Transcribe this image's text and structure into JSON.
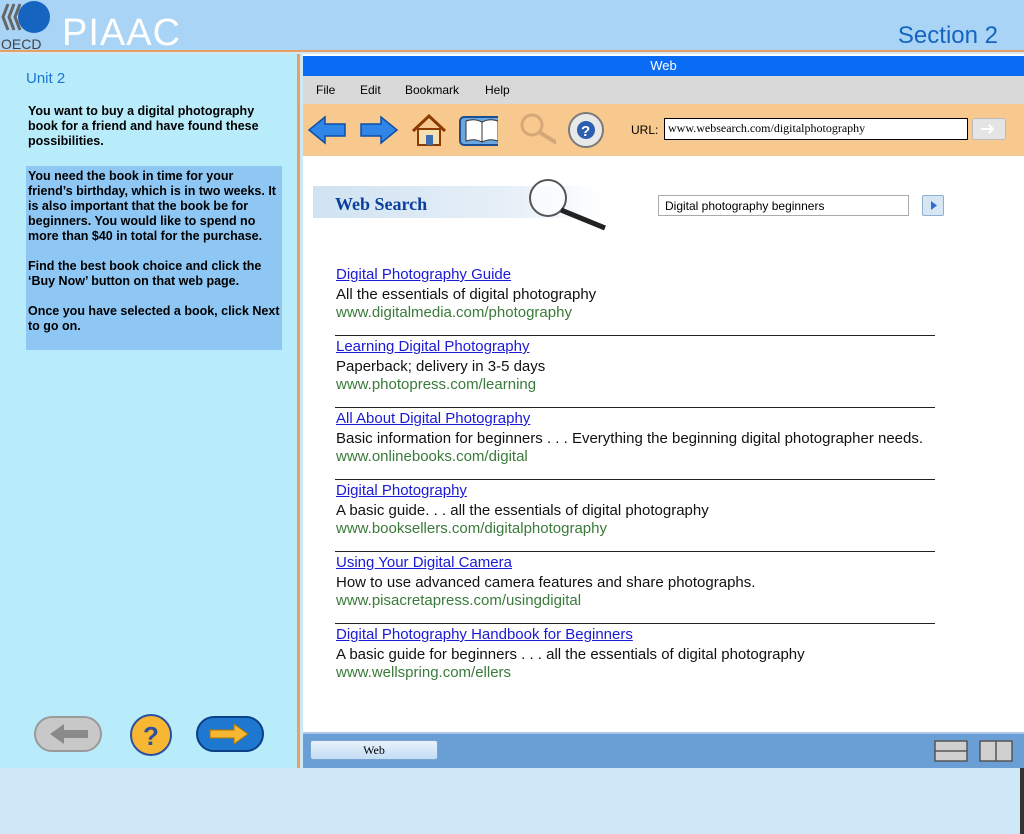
{
  "header": {
    "logo_text": "OECD",
    "app_title": "PIAAC",
    "section": "Section 2"
  },
  "left_panel": {
    "unit": "Unit 2",
    "intro": "You want to buy a digital photography book for a friend and have found these possibilities.",
    "task_paragraphs": [
      "You need the book in time for your friend’s birthday,  which is in two weeks.  It is also important that the book be for beginners.  You would like to spend no more than $40 in total for the purchase.",
      "Find the best book choice and click the ‘Buy Now’ button on that web page.",
      "Once you have selected a book, click Next to go on."
    ]
  },
  "browser": {
    "title": "Web",
    "menu": [
      "File",
      "Edit",
      "Bookmark",
      "Help"
    ],
    "url_label": "URL:",
    "url": "www.websearch.com/digitalphotography",
    "toolbar_icons": [
      "back-arrow-icon",
      "forward-arrow-icon",
      "home-icon",
      "book-icon",
      "search-icon",
      "help-lifebuoy-icon"
    ],
    "search_banner": "Web Search",
    "search_query": "Digital photography beginners",
    "results": [
      {
        "title": "Digital Photography Guide",
        "desc": "All the essentials of digital photography",
        "url": "www.digitalmedia.com/photography"
      },
      {
        "title": "Learning Digital Photography",
        "desc": "Paperback; delivery in 3-5 days",
        "url": "www.photopress.com/learning"
      },
      {
        "title": "All About Digital Photography",
        "desc": "Basic information for beginners . . . Everything the beginning digital photographer needs.",
        "url": "www.onlinebooks.com/digital"
      },
      {
        "title": "Digital Photography",
        "desc": "A basic guide. . . all the essentials of digital photography",
        "url": "www.booksellers.com/digitalphotography"
      },
      {
        "title": "Using Your Digital Camera",
        "desc": "How to use advanced camera features and share photographs.",
        "url": "www.pisacretapress.com/usingdigital"
      },
      {
        "title": "Digital Photography Handbook for Beginners",
        "desc": "A basic guide for beginners . . . all the essentials of digital photography",
        "url": "www.wellspring.com/ellers"
      }
    ],
    "taskbar_tab": "Web"
  },
  "colors": {
    "header_bg": "#a9d4f5",
    "left_bg": "#b9ecfb",
    "task_box_bg": "#8fc7f4",
    "browser_title_bg": "#0a6cf5",
    "toolbar_bg": "#f8c98e",
    "link": "#1a1ad6",
    "url_green": "#3a7a3a"
  }
}
